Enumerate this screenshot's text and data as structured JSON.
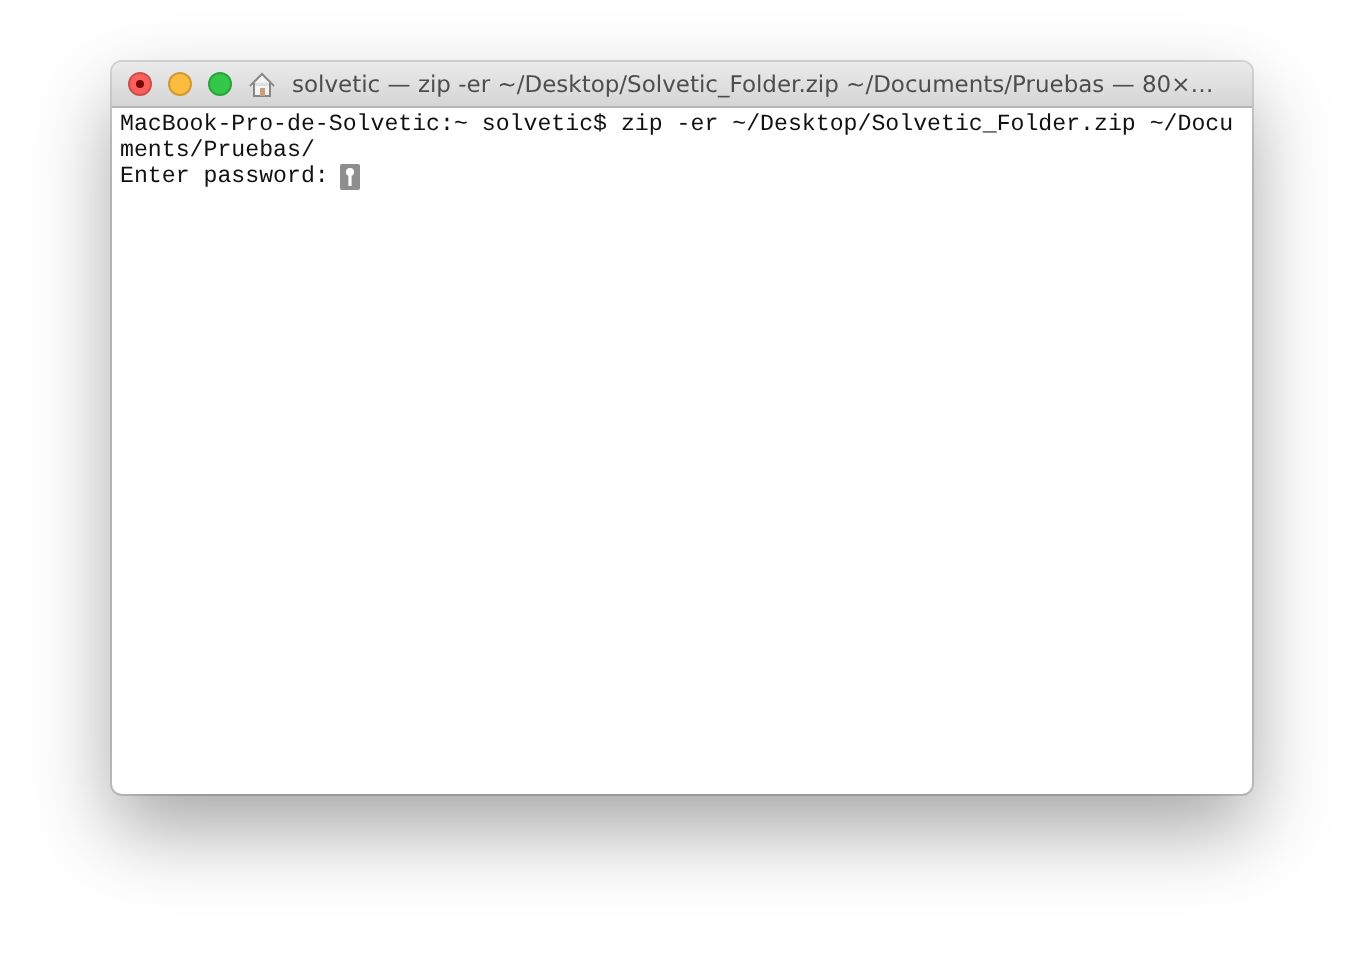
{
  "window": {
    "title": "solvetic — zip -er ~/Desktop/Solvetic_Folder.zip ~/Documents/Pruebas — 80×…",
    "buttons": [
      {
        "kind": "close"
      },
      {
        "kind": "minimize"
      },
      {
        "kind": "zoom"
      }
    ]
  },
  "terminal": {
    "lines": [
      "MacBook-Pro-de-Solvetic:~ solvetic$ zip -er ~/Desktop/Solvetic_Folder.zip ~/Docu",
      "ments/Pruebas/",
      "Enter password:"
    ],
    "cursor": {
      "kind": "key"
    }
  }
}
